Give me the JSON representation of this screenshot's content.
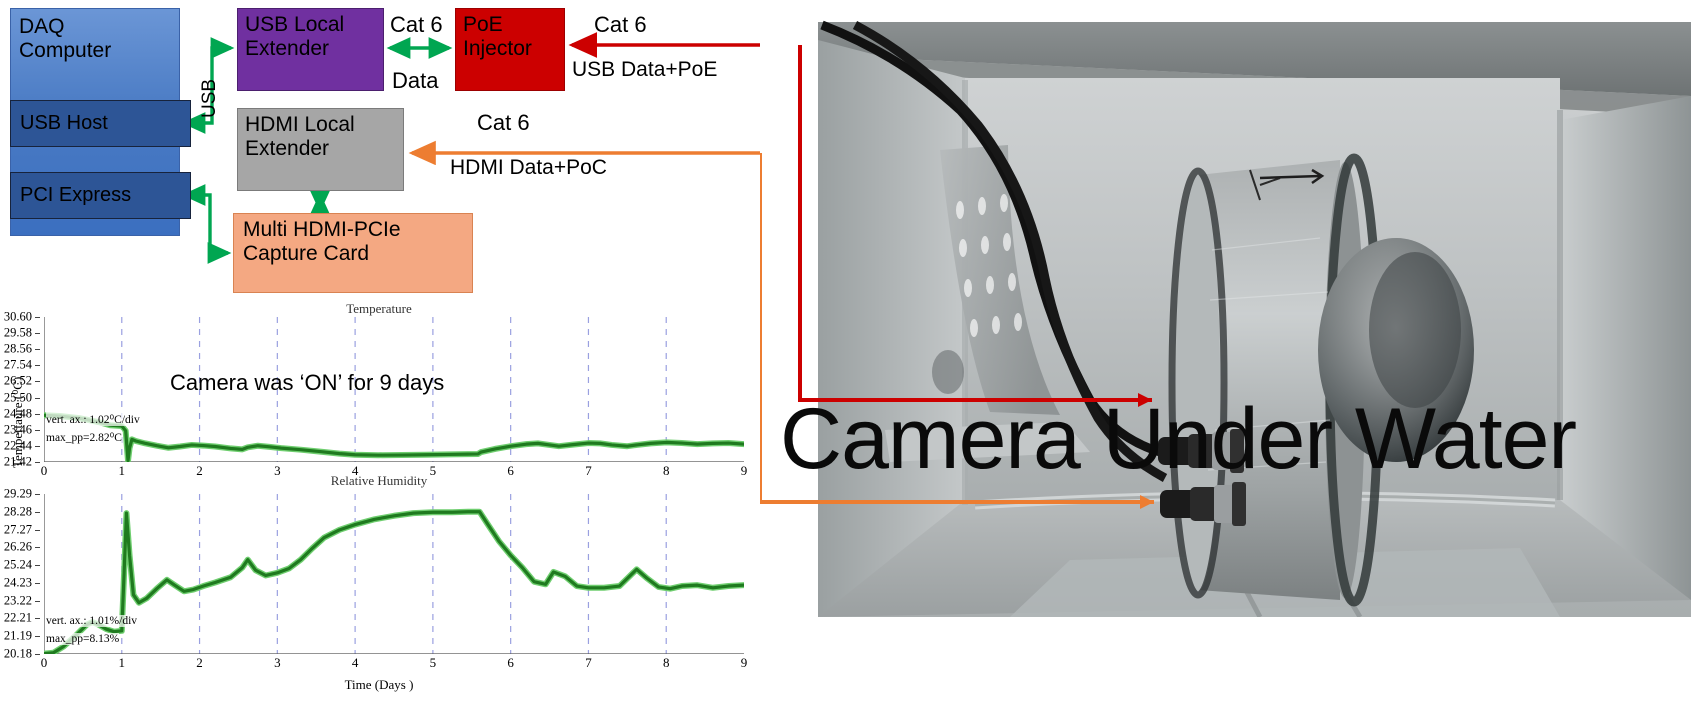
{
  "diagram": {
    "blocks": {
      "daq": {
        "line1": "DAQ",
        "line2": "Computer",
        "color": "#4a7bc4"
      },
      "usb_host": {
        "label": "USB Host",
        "color": "#2d5596"
      },
      "pci_express": {
        "label": "PCI Express",
        "color": "#2d5596"
      },
      "usb_local_extender": {
        "line1": "USB Local",
        "line2": "Extender",
        "color": "#7030a0"
      },
      "poe_injector": {
        "line1": "PoE",
        "line2": "Injector",
        "color": "#cc0000"
      },
      "hdmi_local_extender": {
        "line1": "HDMI Local",
        "line2": "Extender",
        "color": "#a6a6a6"
      },
      "capture_card": {
        "line1": "Multi HDMI-PCIe",
        "line2": "Capture Card",
        "color": "#f4a882"
      }
    },
    "labels": {
      "usb": "USB",
      "cat6_usb_link": "Cat 6",
      "data": "Data",
      "cat6_poe_in": "Cat 6",
      "usb_data_poe": "USB Data+PoE",
      "cat6_hdmi": "Cat 6",
      "hdmi_data_poc": "HDMI Data+PoC"
    },
    "arrow_colors": {
      "green": "#00a651",
      "red": "#cc0000",
      "orange": "#ed7d31"
    }
  },
  "overlay": {
    "camera_on_note": "Camera was ‘ON’ for 9 days"
  },
  "photo": {
    "caption": "Camera Under Water",
    "alt": "Camera housing mounted inside a stainless steel water tank"
  },
  "chart_data": [
    {
      "type": "line",
      "title": "Temperature",
      "xlabel": "",
      "ylabel": "Tempertaure (⁰C)",
      "ylim": [
        21.42,
        30.6
      ],
      "xlim": [
        0,
        9
      ],
      "yticks": [
        "30.60",
        "29.58",
        "28.56",
        "27.54",
        "26.52",
        "25.50",
        "24.48",
        "23.46",
        "22.44",
        "21.42"
      ],
      "xticks": [
        "0",
        "1",
        "2",
        "3",
        "4",
        "5",
        "6",
        "7",
        "8",
        "9"
      ],
      "grid": "vertical dashed",
      "series_color": "#1f7a1f",
      "annotations": [
        "vert. ax.: 1.02⁰C/div",
        "max_pp=2.82⁰C"
      ],
      "x": [
        0.0,
        0.2,
        0.45,
        0.7,
        0.85,
        1.0,
        1.05,
        1.08,
        1.1,
        1.13,
        1.18,
        1.3,
        1.45,
        1.6,
        1.75,
        1.9,
        2.05,
        2.2,
        2.4,
        2.55,
        2.62,
        2.75,
        2.9,
        3.05,
        3.3,
        3.55,
        3.8,
        4.0,
        4.3,
        4.6,
        4.9,
        5.2,
        5.45,
        5.58,
        5.62,
        5.8,
        6.0,
        6.2,
        6.35,
        6.5,
        6.62,
        6.8,
        7.0,
        7.15,
        7.3,
        7.5,
        7.62,
        7.8,
        8.0,
        8.2,
        8.4,
        8.6,
        8.8,
        9.0
      ],
      "y": [
        24.38,
        24.33,
        24.2,
        23.95,
        23.75,
        23.7,
        23.4,
        21.5,
        22.3,
        22.85,
        22.75,
        22.6,
        22.45,
        22.32,
        22.4,
        22.5,
        22.46,
        22.4,
        22.28,
        22.22,
        22.35,
        22.45,
        22.38,
        22.3,
        22.2,
        22.08,
        21.95,
        21.88,
        21.85,
        21.86,
        21.88,
        21.9,
        21.92,
        21.93,
        22.05,
        22.25,
        22.42,
        22.55,
        22.6,
        22.5,
        22.42,
        22.52,
        22.62,
        22.6,
        22.5,
        22.42,
        22.5,
        22.6,
        22.66,
        22.62,
        22.55,
        22.6,
        22.62,
        22.55
      ]
    },
    {
      "type": "line",
      "title": "Relative Humidity",
      "xlabel": "Time (Days )",
      "ylabel": "",
      "ylim": [
        20.18,
        29.29
      ],
      "xlim": [
        0,
        9
      ],
      "yticks": [
        "29.29",
        "28.28",
        "27.27",
        "26.26",
        "25.24",
        "24.23",
        "23.22",
        "22.21",
        "21.19",
        "20.18"
      ],
      "xticks": [
        "0",
        "1",
        "2",
        "3",
        "4",
        "5",
        "6",
        "7",
        "8",
        "9"
      ],
      "grid": "vertical dashed",
      "series_color": "#1f7a1f",
      "annotations": [
        "vert. ax.: 1.01%/div",
        "max_pp=8.13%"
      ],
      "x": [
        0.0,
        0.12,
        0.25,
        0.4,
        0.55,
        0.62,
        0.7,
        0.8,
        0.9,
        1.0,
        1.03,
        1.06,
        1.1,
        1.15,
        1.22,
        1.32,
        1.45,
        1.58,
        1.68,
        1.8,
        1.92,
        2.05,
        2.2,
        2.4,
        2.55,
        2.62,
        2.72,
        2.85,
        3.0,
        3.15,
        3.3,
        3.45,
        3.6,
        3.8,
        4.0,
        4.25,
        4.5,
        4.75,
        5.0,
        5.25,
        5.45,
        5.6,
        5.7,
        5.85,
        6.0,
        6.15,
        6.3,
        6.45,
        6.55,
        6.7,
        6.85,
        7.0,
        7.2,
        7.4,
        7.55,
        7.62,
        7.75,
        7.9,
        8.05,
        8.2,
        8.4,
        8.6,
        8.8,
        9.0
      ],
      "y": [
        20.2,
        20.25,
        20.6,
        21.2,
        21.85,
        22.0,
        21.85,
        21.6,
        21.45,
        21.5,
        24.8,
        28.2,
        25.8,
        23.55,
        23.1,
        23.35,
        23.9,
        24.4,
        24.1,
        23.75,
        23.85,
        24.05,
        24.25,
        24.55,
        25.1,
        25.55,
        24.95,
        24.65,
        24.8,
        25.05,
        25.55,
        26.2,
        26.8,
        27.25,
        27.55,
        27.85,
        28.05,
        28.2,
        28.25,
        28.25,
        28.28,
        28.28,
        27.6,
        26.6,
        25.8,
        25.1,
        24.3,
        24.15,
        24.85,
        24.6,
        24.05,
        23.95,
        23.95,
        24.05,
        24.7,
        25.0,
        24.5,
        24.0,
        23.9,
        24.05,
        24.1,
        23.95,
        24.05,
        24.1
      ]
    }
  ]
}
